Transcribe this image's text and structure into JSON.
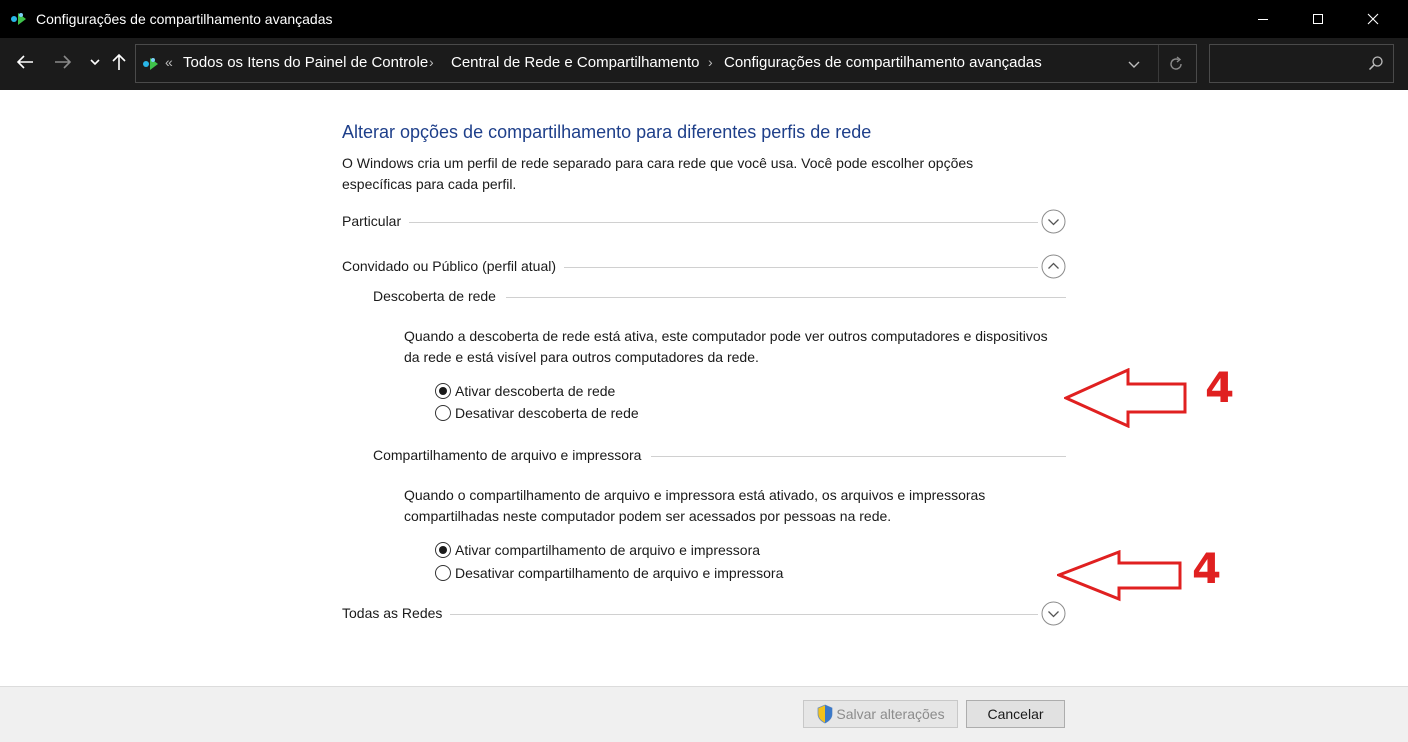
{
  "window": {
    "title": "Configurações de compartilhamento avançadas"
  },
  "address_bar": {
    "overflow": "«",
    "crumbs": [
      "Todos os Itens do Painel de Controle",
      "Central de Rede e Compartilhamento",
      "Configurações de compartilhamento avançadas"
    ],
    "separator": "›"
  },
  "search": {
    "placeholder": ""
  },
  "main": {
    "heading": "Alterar opções de compartilhamento para diferentes perfis de rede",
    "intro": "O Windows cria um perfil de rede separado para cara rede que você usa. Você pode escolher opções específicas para cada perfil.",
    "profiles": [
      {
        "label": "Particular",
        "expanded": false
      },
      {
        "label": "Convidado ou Público (perfil atual)",
        "expanded": true
      },
      {
        "label": "Todas as Redes",
        "expanded": false
      }
    ],
    "network_discovery": {
      "title": "Descoberta de rede",
      "description": "Quando a descoberta de rede está ativa, este computador pode ver outros computadores e dispositivos da rede e está visível para outros computadores da rede.",
      "options": [
        "Ativar descoberta de rede",
        "Desativar descoberta de rede"
      ],
      "selected": 0
    },
    "file_sharing": {
      "title": "Compartilhamento de arquivo e impressora",
      "description": "Quando o compartilhamento de arquivo e impressora está ativado, os arquivos e impressoras compartilhadas neste computador podem ser acessados por pessoas na rede.",
      "options": [
        "Ativar compartilhamento de arquivo e impressora",
        "Desativar compartilhamento de arquivo e impressora"
      ],
      "selected": 0
    }
  },
  "annotations": {
    "color": "#e02020",
    "labels": [
      "4",
      "4"
    ]
  },
  "footer": {
    "save_label": "Salvar alterações",
    "cancel_label": "Cancelar"
  },
  "colors": {
    "titlebar": "#000000",
    "navbar": "#1b1b1b",
    "heading": "#1e3f8a",
    "footer": "#f0f0f0"
  }
}
